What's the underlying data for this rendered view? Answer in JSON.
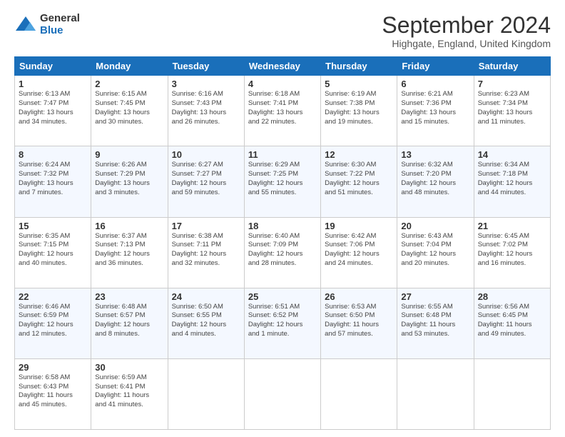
{
  "header": {
    "logo_general": "General",
    "logo_blue": "Blue",
    "month_title": "September 2024",
    "location": "Highgate, England, United Kingdom"
  },
  "calendar": {
    "days_of_week": [
      "Sunday",
      "Monday",
      "Tuesday",
      "Wednesday",
      "Thursday",
      "Friday",
      "Saturday"
    ],
    "weeks": [
      [
        {
          "num": "",
          "info": ""
        },
        {
          "num": "2",
          "info": "Sunrise: 6:15 AM\nSunset: 7:45 PM\nDaylight: 13 hours\nand 30 minutes."
        },
        {
          "num": "3",
          "info": "Sunrise: 6:16 AM\nSunset: 7:43 PM\nDaylight: 13 hours\nand 26 minutes."
        },
        {
          "num": "4",
          "info": "Sunrise: 6:18 AM\nSunset: 7:41 PM\nDaylight: 13 hours\nand 22 minutes."
        },
        {
          "num": "5",
          "info": "Sunrise: 6:19 AM\nSunset: 7:38 PM\nDaylight: 13 hours\nand 19 minutes."
        },
        {
          "num": "6",
          "info": "Sunrise: 6:21 AM\nSunset: 7:36 PM\nDaylight: 13 hours\nand 15 minutes."
        },
        {
          "num": "7",
          "info": "Sunrise: 6:23 AM\nSunset: 7:34 PM\nDaylight: 13 hours\nand 11 minutes."
        }
      ],
      [
        {
          "num": "1",
          "info": "Sunrise: 6:13 AM\nSunset: 7:47 PM\nDaylight: 13 hours\nand 34 minutes."
        },
        {
          "num": "8",
          "info": ""
        },
        {
          "num": "",
          "info": ""
        },
        {
          "num": "",
          "info": ""
        },
        {
          "num": "",
          "info": ""
        },
        {
          "num": "",
          "info": ""
        },
        {
          "num": "",
          "info": ""
        }
      ],
      [
        {
          "num": "8",
          "info": "Sunrise: 6:24 AM\nSunset: 7:32 PM\nDaylight: 13 hours\nand 7 minutes."
        },
        {
          "num": "9",
          "info": "Sunrise: 6:26 AM\nSunset: 7:29 PM\nDaylight: 13 hours\nand 3 minutes."
        },
        {
          "num": "10",
          "info": "Sunrise: 6:27 AM\nSunset: 7:27 PM\nDaylight: 12 hours\nand 59 minutes."
        },
        {
          "num": "11",
          "info": "Sunrise: 6:29 AM\nSunset: 7:25 PM\nDaylight: 12 hours\nand 55 minutes."
        },
        {
          "num": "12",
          "info": "Sunrise: 6:30 AM\nSunset: 7:22 PM\nDaylight: 12 hours\nand 51 minutes."
        },
        {
          "num": "13",
          "info": "Sunrise: 6:32 AM\nSunset: 7:20 PM\nDaylight: 12 hours\nand 48 minutes."
        },
        {
          "num": "14",
          "info": "Sunrise: 6:34 AM\nSunset: 7:18 PM\nDaylight: 12 hours\nand 44 minutes."
        }
      ],
      [
        {
          "num": "15",
          "info": "Sunrise: 6:35 AM\nSunset: 7:15 PM\nDaylight: 12 hours\nand 40 minutes."
        },
        {
          "num": "16",
          "info": "Sunrise: 6:37 AM\nSunset: 7:13 PM\nDaylight: 12 hours\nand 36 minutes."
        },
        {
          "num": "17",
          "info": "Sunrise: 6:38 AM\nSunset: 7:11 PM\nDaylight: 12 hours\nand 32 minutes."
        },
        {
          "num": "18",
          "info": "Sunrise: 6:40 AM\nSunset: 7:09 PM\nDaylight: 12 hours\nand 28 minutes."
        },
        {
          "num": "19",
          "info": "Sunrise: 6:42 AM\nSunset: 7:06 PM\nDaylight: 12 hours\nand 24 minutes."
        },
        {
          "num": "20",
          "info": "Sunrise: 6:43 AM\nSunset: 7:04 PM\nDaylight: 12 hours\nand 20 minutes."
        },
        {
          "num": "21",
          "info": "Sunrise: 6:45 AM\nSunset: 7:02 PM\nDaylight: 12 hours\nand 16 minutes."
        }
      ],
      [
        {
          "num": "22",
          "info": "Sunrise: 6:46 AM\nSunset: 6:59 PM\nDaylight: 12 hours\nand 12 minutes."
        },
        {
          "num": "23",
          "info": "Sunrise: 6:48 AM\nSunset: 6:57 PM\nDaylight: 12 hours\nand 8 minutes."
        },
        {
          "num": "24",
          "info": "Sunrise: 6:50 AM\nSunset: 6:55 PM\nDaylight: 12 hours\nand 4 minutes."
        },
        {
          "num": "25",
          "info": "Sunrise: 6:51 AM\nSunset: 6:52 PM\nDaylight: 12 hours\nand 1 minute."
        },
        {
          "num": "26",
          "info": "Sunrise: 6:53 AM\nSunset: 6:50 PM\nDaylight: 11 hours\nand 57 minutes."
        },
        {
          "num": "27",
          "info": "Sunrise: 6:55 AM\nSunset: 6:48 PM\nDaylight: 11 hours\nand 53 minutes."
        },
        {
          "num": "28",
          "info": "Sunrise: 6:56 AM\nSunset: 6:45 PM\nDaylight: 11 hours\nand 49 minutes."
        }
      ],
      [
        {
          "num": "29",
          "info": "Sunrise: 6:58 AM\nSunset: 6:43 PM\nDaylight: 11 hours\nand 45 minutes."
        },
        {
          "num": "30",
          "info": "Sunrise: 6:59 AM\nSunset: 6:41 PM\nDaylight: 11 hours\nand 41 minutes."
        },
        {
          "num": "",
          "info": ""
        },
        {
          "num": "",
          "info": ""
        },
        {
          "num": "",
          "info": ""
        },
        {
          "num": "",
          "info": ""
        },
        {
          "num": "",
          "info": ""
        }
      ]
    ]
  }
}
